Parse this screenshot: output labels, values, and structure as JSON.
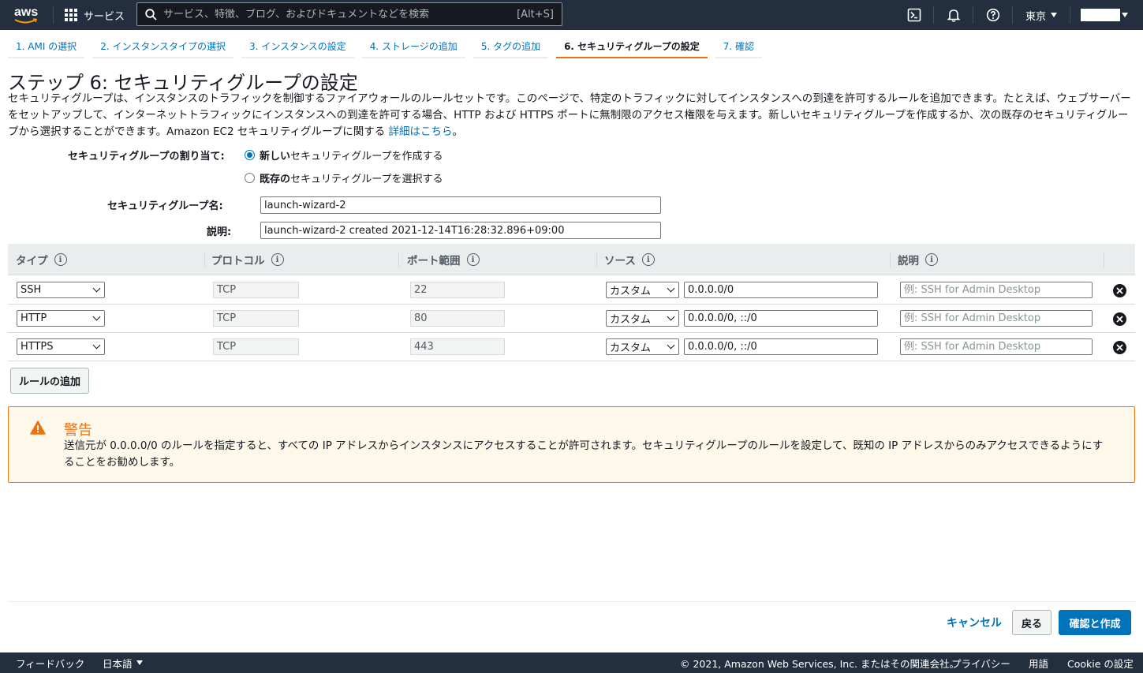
{
  "topnav": {
    "logo_text": "aws",
    "services_label": "サービス",
    "search_placeholder": "サービス、特徴、ブログ、およびドキュメントなどを検索",
    "search_shortcut": "[Alt+S]",
    "region_label": "東京",
    "icons": [
      "cloudshell-icon",
      "bell-icon",
      "help-icon"
    ]
  },
  "tabs": [
    {
      "label": "1. AMI の選択",
      "active": false
    },
    {
      "label": "2. インスタンスタイプの選択",
      "active": false
    },
    {
      "label": "3. インスタンスの設定",
      "active": false
    },
    {
      "label": "4. ストレージの追加",
      "active": false
    },
    {
      "label": "5. タグの追加",
      "active": false
    },
    {
      "label": "6. セキュリティグループの設定",
      "active": true
    },
    {
      "label": "7. 確認",
      "active": false
    }
  ],
  "page": {
    "title": "ステップ 6: セキュリティグループの設定",
    "description": "セキュリティグループは、インスタンスのトラフィックを制御するファイアウォールのルールセットです。このページで、特定のトラフィックに対してインスタンスへの到達を許可するルールを追加できます。たとえば、ウェブサーバーをセットアップして、インターネットトラフィックにインスタンスへの到達を許可する場合、HTTP および HTTPS ポートに無制限のアクセス権限を与えます。新しいセキュリティグループを作成するか、次の既存のセキュリティグループから選択することができます。Amazon EC2 セキュリティグループに関する ",
    "details_link": "詳細はこちら",
    "description_end": "。"
  },
  "form": {
    "assign_label": "セキュリティグループの割り当て:",
    "radio_new_bold": "新しい",
    "radio_new_rest": "セキュリティグループを作成する",
    "radio_existing_bold": "既存の",
    "radio_existing_rest": "セキュリティグループを選択する",
    "selected": "new",
    "name_label": "セキュリティグループ名:",
    "name_value": "launch-wizard-2",
    "desc_label": "説明:",
    "desc_value": "launch-wizard-2 created 2021-12-14T16:28:32.896+09:00"
  },
  "table": {
    "headers": [
      "タイプ",
      "プロトコル",
      "ポート範囲",
      "ソース",
      "説明"
    ],
    "rows": [
      {
        "type": "SSH",
        "protocol": "TCP",
        "port": "22",
        "source_type": "カスタム",
        "source": "0.0.0.0/0",
        "desc_placeholder": "例: SSH for Admin Desktop"
      },
      {
        "type": "HTTP",
        "protocol": "TCP",
        "port": "80",
        "source_type": "カスタム",
        "source": "0.0.0.0/0, ::/0",
        "desc_placeholder": "例: SSH for Admin Desktop"
      },
      {
        "type": "HTTPS",
        "protocol": "TCP",
        "port": "443",
        "source_type": "カスタム",
        "source": "0.0.0.0/0, ::/0",
        "desc_placeholder": "例: SSH for Admin Desktop"
      }
    ],
    "add_rule_label": "ルールの追加"
  },
  "warning": {
    "title": "警告",
    "text": "送信元が 0.0.0.0/0 のルールを指定すると、すべての IP アドレスからインスタンスにアクセスすることが許可されます。セキュリティグループのルールを設定して、既知の IP アドレスからのみアクセスできるようにすることをお勧めします。"
  },
  "actions": {
    "cancel": "キャンセル",
    "back": "戻る",
    "review_create": "確認と作成"
  },
  "footer": {
    "feedback": "フィードバック",
    "language": "日本語",
    "copyright": "© 2021, Amazon Web Services, Inc. またはその関連会社。",
    "privacy": "プライバシー",
    "terms": "用語",
    "cookie": "Cookie の設定"
  },
  "colors": {
    "nav_bg": "#232f3e",
    "link": "#0073bb",
    "accent": "#ec7211",
    "warning_bg": "#fef8ea"
  }
}
